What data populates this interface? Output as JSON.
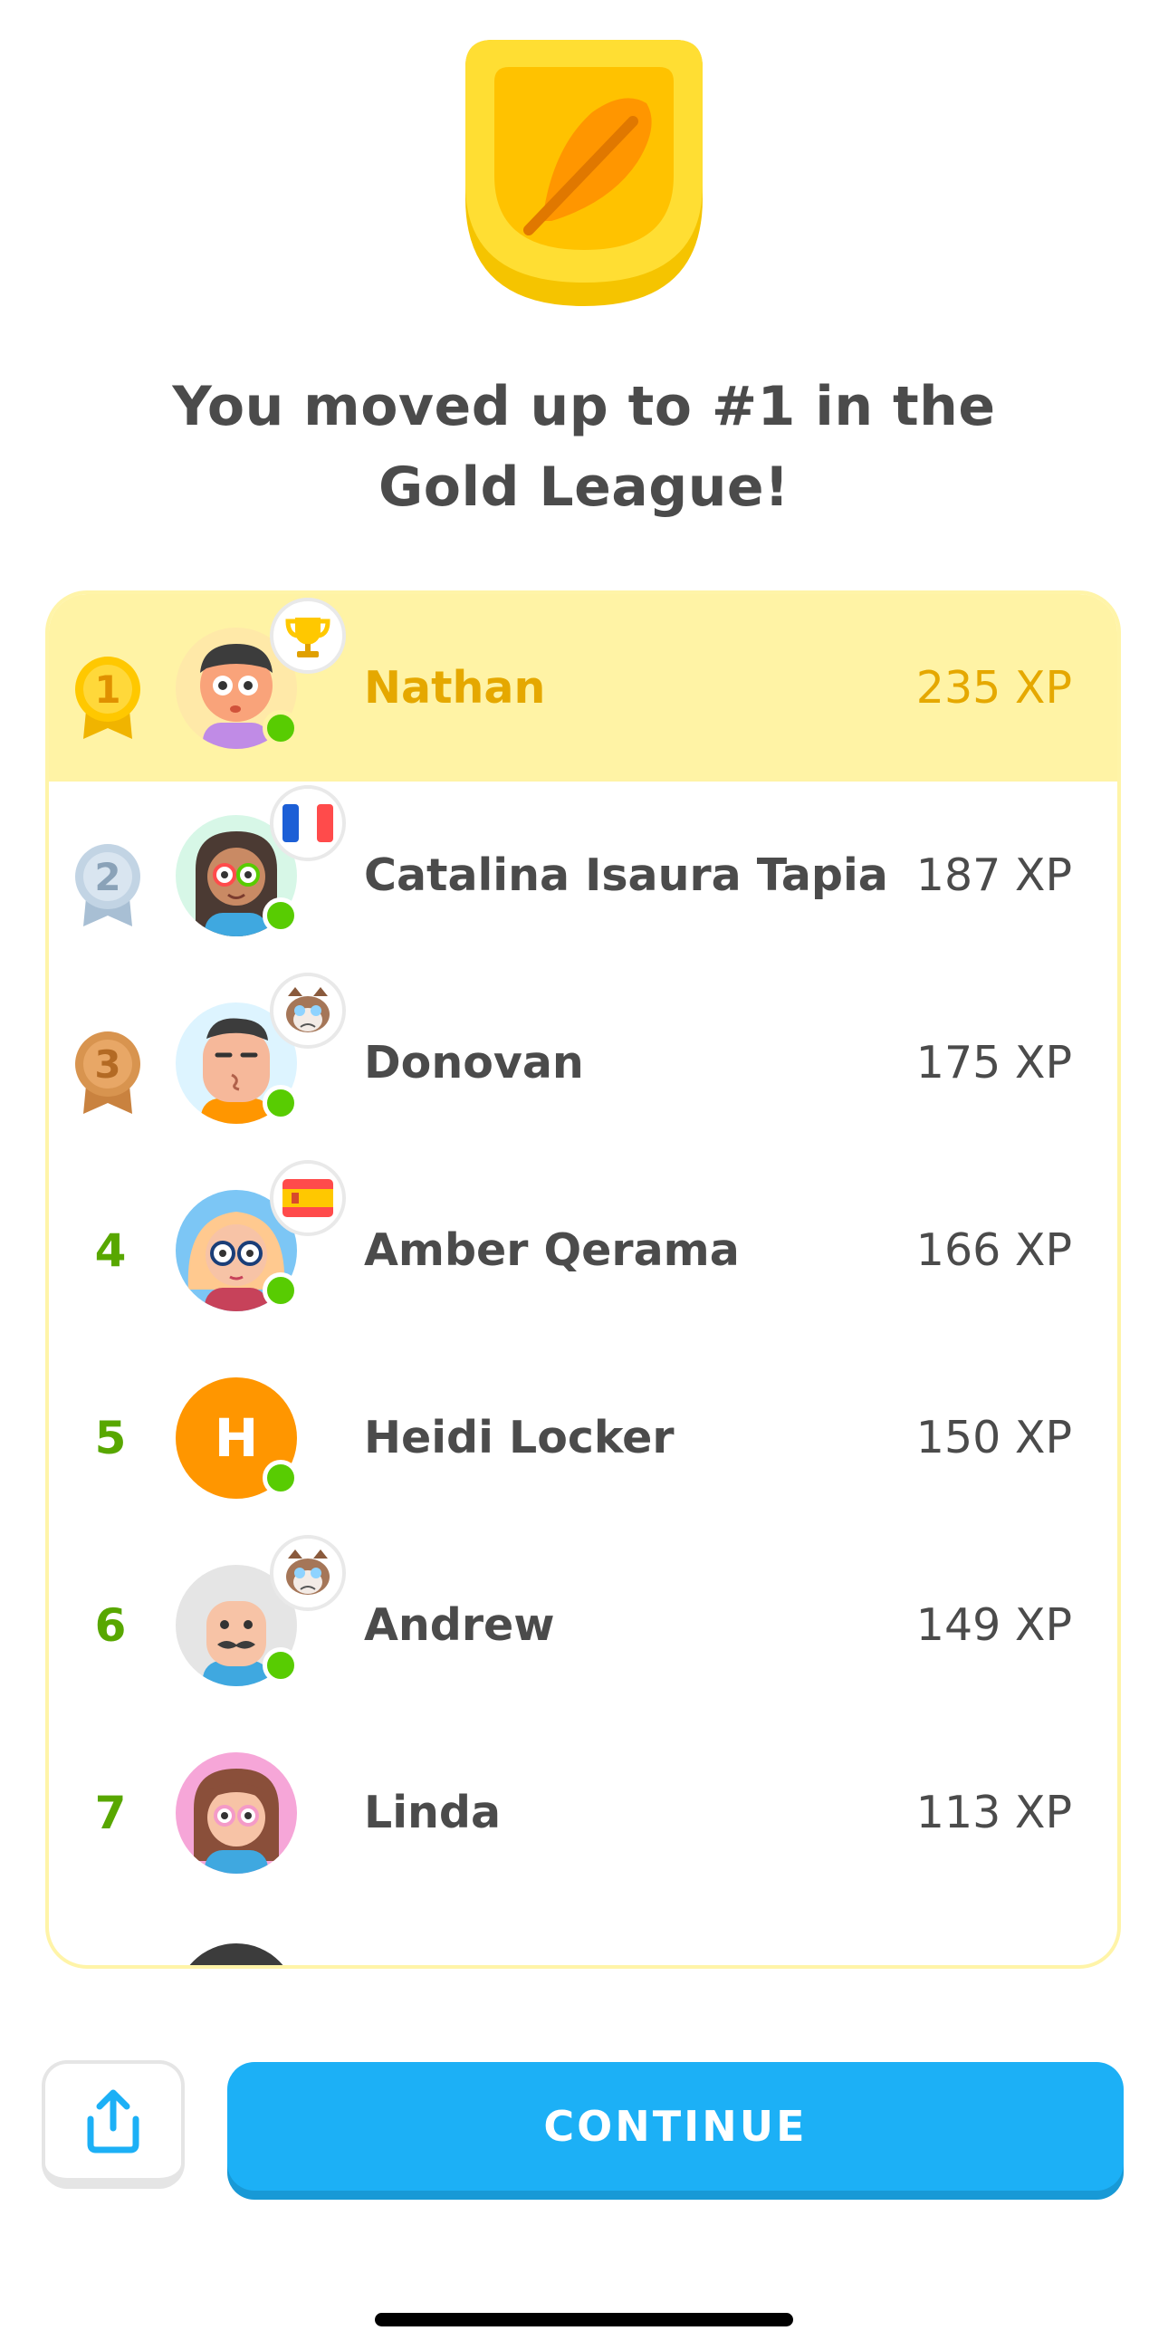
{
  "headline": {
    "line1": "You moved up to #1 in the",
    "line2": "Gold League!"
  },
  "leaderboard": [
    {
      "rank": "1",
      "name": "Nathan",
      "xp": "235 XP",
      "flair": "trophy-icon",
      "medal": "gold"
    },
    {
      "rank": "2",
      "name": "Catalina Isaura Tapia",
      "xp": "187 XP",
      "flair": "france-flag-icon",
      "medal": "silver"
    },
    {
      "rank": "3",
      "name": "Donovan",
      "xp": "175 XP",
      "flair": "grumpy-cat-icon",
      "medal": "bronze"
    },
    {
      "rank": "4",
      "name": "Amber Qerama",
      "xp": "166 XP",
      "flair": "spain-flag-icon"
    },
    {
      "rank": "5",
      "name": "Heidi Locker",
      "xp": "150 XP",
      "avatar_letter": "H"
    },
    {
      "rank": "6",
      "name": "Andrew",
      "xp": "149 XP",
      "flair": "grumpy-cat-icon"
    },
    {
      "rank": "7",
      "name": "Linda",
      "xp": "113 XP"
    }
  ],
  "actions": {
    "share_icon": "share-icon",
    "continue_label": "CONTINUE"
  },
  "colors": {
    "gold": "#ffd900",
    "highlight_row": "#fff3a5",
    "rank_green": "#58a700",
    "online_dot": "#58cc02",
    "continue_blue": "#1cb0f6"
  }
}
